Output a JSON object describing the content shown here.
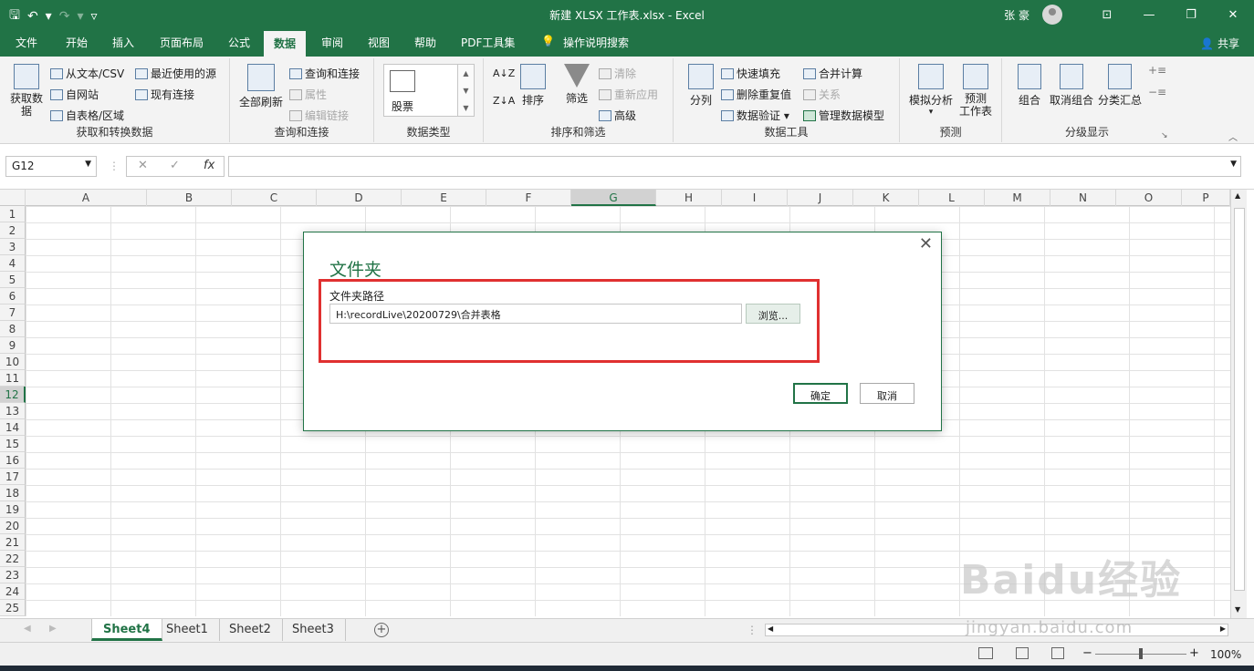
{
  "app": {
    "title": "新建 XLSX 工作表.xlsx  -  Excel",
    "user": "张 豪",
    "qat": {
      "save": "🖫",
      "undo": "↶",
      "undo_dd": "▾",
      "redo": "↷",
      "redo_dd": "▾",
      "customize": "▿"
    },
    "window": {
      "ribbon_opts": "⊡",
      "minimize": "—",
      "restore": "❐",
      "close": "✕"
    }
  },
  "menu": {
    "tabs": [
      "文件",
      "开始",
      "插入",
      "页面布局",
      "公式",
      "数据",
      "审阅",
      "视图",
      "帮助",
      "PDF工具集"
    ],
    "active_tab": "数据",
    "tellme": "操作说明搜索",
    "share": "共享"
  },
  "ribbon": {
    "get_transform": {
      "label": "获取和转换数据",
      "get_data": "获取数\n据",
      "from_csv": "从文本/CSV",
      "from_web": "自网站",
      "from_table": "自表格/区域",
      "recent_sources": "最近使用的源",
      "existing_conn": "现有连接"
    },
    "queries": {
      "label": "查询和连接",
      "refresh_all": "全部刷新",
      "queries_conn": "查询和连接",
      "properties": "属性",
      "edit_links": "编辑链接"
    },
    "data_types": {
      "label": "数据类型",
      "stocks": "股票"
    },
    "sort_filter": {
      "label": "排序和筛选",
      "sort": "排序",
      "filter": "筛选",
      "clear": "清除",
      "reapply": "重新应用",
      "advanced": "高级"
    },
    "data_tools": {
      "label": "数据工具",
      "text_to_columns": "分列",
      "flash_fill": "快速填充",
      "remove_dup": "删除重复值",
      "validation": "数据验证",
      "consolidate": "合并计算",
      "relationships": "关系",
      "manage_model": "管理数据模型"
    },
    "forecast": {
      "label": "预测",
      "what_if": "模拟分析",
      "forecast_sheet": "预测\n工作表"
    },
    "outline": {
      "label": "分级显示",
      "group": "组合",
      "ungroup": "取消组合",
      "subtotal": "分类汇总"
    }
  },
  "formula_bar": {
    "name_box": "G12",
    "cancel": "✕",
    "enter": "✓",
    "fx": "fx",
    "formula": ""
  },
  "grid": {
    "columns": [
      "A",
      "B",
      "C",
      "D",
      "E",
      "F",
      "G",
      "H",
      "I",
      "J",
      "K",
      "L",
      "M",
      "N",
      "O",
      "P"
    ],
    "rows": [
      "1",
      "2",
      "3",
      "4",
      "5",
      "6",
      "7",
      "8",
      "9",
      "10",
      "11",
      "12",
      "13",
      "14",
      "15",
      "16",
      "17",
      "18",
      "19",
      "20",
      "21",
      "22",
      "23",
      "24",
      "25"
    ],
    "selected_col": "G",
    "selected_row": "12"
  },
  "sheets": {
    "tabs": [
      "Sheet4",
      "Sheet1",
      "Sheet2",
      "Sheet3"
    ],
    "active": "Sheet4"
  },
  "status": {
    "zoom": "100%"
  },
  "dialog": {
    "title": "文件夹",
    "path_label": "文件夹路径",
    "path_value": "H:\\recordLive\\20200729\\合并表格",
    "browse": "浏览...",
    "ok": "确定",
    "cancel": "取消",
    "close": "✕"
  },
  "watermark": {
    "text": "Baidu经验",
    "url": "jingyan.baidu.com"
  },
  "colors": {
    "accent": "#217346",
    "highlight": "#e03030"
  }
}
